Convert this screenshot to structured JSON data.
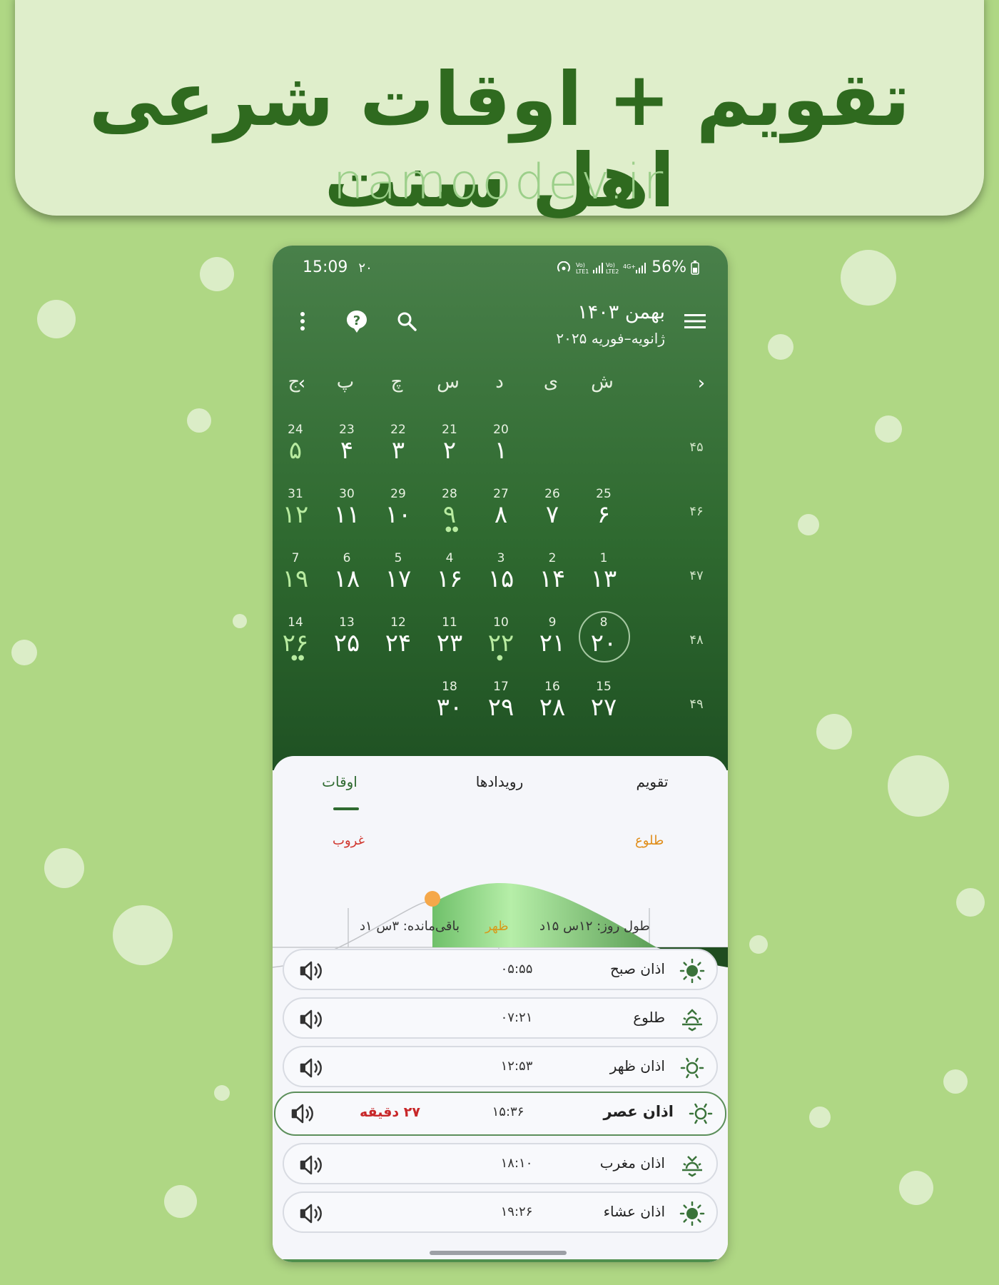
{
  "banner": {
    "title": "تقویم + اوقات شرعی اهل سنت",
    "url": "namoodev.ir"
  },
  "status_bar": {
    "time": "15:09",
    "date_badge": "۲۰",
    "battery": "56%"
  },
  "app_bar": {
    "month_title": "بهمن ۱۴۰۳",
    "month_subtitle": "ژانویه–فوریه ۲۰۲۵",
    "icons": [
      "menu-icon",
      "search-icon",
      "help-icon",
      "more-vert-icon"
    ]
  },
  "calendar": {
    "weekdays": [
      "ش",
      "ی",
      "د",
      "س",
      "چ",
      "پ",
      "ج"
    ],
    "week_numbers": [
      "۴۵",
      "۴۶",
      "۴۷",
      "۴۸",
      "۴۹"
    ],
    "weeks": [
      [
        null,
        null,
        {
          "g": "20",
          "p": "۱"
        },
        {
          "g": "21",
          "p": "۲"
        },
        {
          "g": "22",
          "p": "۳"
        },
        {
          "g": "23",
          "p": "۴"
        },
        {
          "g": "24",
          "p": "۵",
          "holiday": true
        }
      ],
      [
        {
          "g": "25",
          "p": "۶"
        },
        {
          "g": "26",
          "p": "۷"
        },
        {
          "g": "27",
          "p": "۸"
        },
        {
          "g": "28",
          "p": "۹",
          "holiday": true,
          "dots": "●●"
        },
        {
          "g": "29",
          "p": "۱۰"
        },
        {
          "g": "30",
          "p": "۱۱"
        },
        {
          "g": "31",
          "p": "۱۲",
          "holiday": true
        }
      ],
      [
        {
          "g": "1",
          "p": "۱۳"
        },
        {
          "g": "2",
          "p": "۱۴"
        },
        {
          "g": "3",
          "p": "۱۵"
        },
        {
          "g": "4",
          "p": "۱۶"
        },
        {
          "g": "5",
          "p": "۱۷"
        },
        {
          "g": "6",
          "p": "۱۸"
        },
        {
          "g": "7",
          "p": "۱۹",
          "holiday": true
        }
      ],
      [
        {
          "g": "8",
          "p": "۲۰",
          "today": true
        },
        {
          "g": "9",
          "p": "۲۱"
        },
        {
          "g": "10",
          "p": "۲۲",
          "holiday": true,
          "dots": "●"
        },
        {
          "g": "11",
          "p": "۲۳"
        },
        {
          "g": "12",
          "p": "۲۴"
        },
        {
          "g": "13",
          "p": "۲۵"
        },
        {
          "g": "14",
          "p": "۲۶",
          "holiday": true,
          "dots": "●●"
        }
      ],
      [
        {
          "g": "15",
          "p": "۲۷"
        },
        {
          "g": "16",
          "p": "۲۸"
        },
        {
          "g": "17",
          "p": "۲۹"
        },
        {
          "g": "18",
          "p": "۳۰"
        },
        null,
        null,
        null
      ]
    ]
  },
  "tabs": {
    "calendar": "تقویم",
    "events": "رویدادها",
    "times": "اوقات"
  },
  "sun_chart": {
    "sunset_label": "غروب",
    "sunrise_label": "طلوع",
    "remaining": "باقی‌مانده: ۳س ۱د",
    "noon_label": "ظهر",
    "day_length": "طول روز: ۱۲س ۱۵د"
  },
  "prayers": [
    {
      "name": "اذان صبح",
      "time": "۰۵:۵۵",
      "icon": "sun-icon"
    },
    {
      "name": "طلوع",
      "time": "۰۷:۲۱",
      "icon": "sunrise-icon"
    },
    {
      "name": "اذان ظهر",
      "time": "۱۲:۵۳",
      "icon": "sun-outline-icon"
    },
    {
      "name": "اذان عصر",
      "time": "۱۵:۳۶",
      "icon": "sun-outline-icon",
      "active": true,
      "remaining": "۲۷ دقیقه"
    },
    {
      "name": "اذان مغرب",
      "time": "۱۸:۱۰",
      "icon": "sunset-icon"
    },
    {
      "name": "اذان عشاء",
      "time": "۱۹:۲۶",
      "icon": "sun-icon"
    }
  ],
  "colors": {
    "primary": "#2f6a30",
    "background": "#afd784",
    "banner": "#dfeecb",
    "holiday": "#b8eba0",
    "sunrise": "#e08e1a",
    "sunset": "#d0342c"
  }
}
